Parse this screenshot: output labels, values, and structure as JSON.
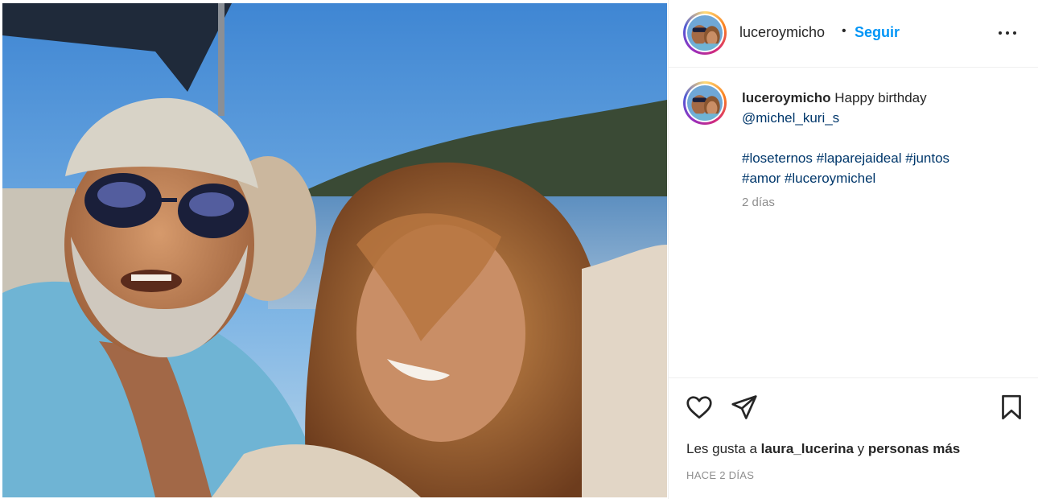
{
  "post": {
    "username": "luceroymicho",
    "separator": "•",
    "follow_label": "Seguir",
    "more_icon": "more-horizontal-icon",
    "caption": {
      "username": "luceroymicho",
      "text": "Happy birthday",
      "mention": "@michel_kuri_s",
      "hashtags_line1": [
        "#loseternos",
        "#laparejaideal",
        "#juntos"
      ],
      "hashtags_line2": [
        "#amor",
        "#luceroymichel"
      ],
      "time": "2 días"
    },
    "actions": {
      "like_icon": "heart-icon",
      "share_icon": "paper-plane-icon",
      "save_icon": "bookmark-icon"
    },
    "likes": {
      "prefix": "Les gusta a",
      "user": "laura_lucerina",
      "connector": "y",
      "suffix": "personas más"
    },
    "timestamp": "HACE 2 DÍAS"
  },
  "colors": {
    "accent": "#0095f6",
    "link": "#00376b",
    "muted": "#8e8e8e",
    "text": "#262626"
  }
}
